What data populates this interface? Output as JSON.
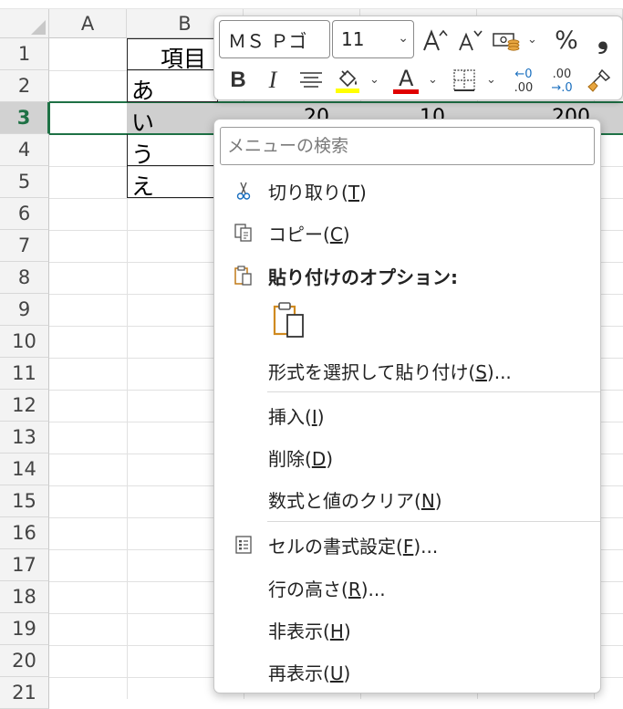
{
  "sheet": {
    "columns": [
      "A",
      "B"
    ],
    "rows": [
      "1",
      "2",
      "3",
      "4",
      "5",
      "6",
      "7",
      "8",
      "9",
      "10",
      "11",
      "12",
      "13",
      "14",
      "15",
      "16",
      "17",
      "18",
      "19",
      "20",
      "21"
    ],
    "cells": {
      "b1": "項目",
      "b2": "あ",
      "b3": "い",
      "b4": "う",
      "b5": "え",
      "c3": "20",
      "d3": "10",
      "e3": "200"
    },
    "selected_row": "3",
    "accent_color": "#1e7145"
  },
  "mini_toolbar": {
    "font_name": "ＭＳ Ｐゴ",
    "font_size": "11",
    "icons": [
      "increase-font-size-icon",
      "decrease-font-size-icon",
      "accounting-format-icon",
      "percent-style-icon",
      "comma-style-icon",
      "bold-icon",
      "italic-icon",
      "center-align-icon",
      "fill-color-icon",
      "font-color-icon",
      "borders-icon",
      "increase-decimal-icon",
      "decrease-decimal-icon",
      "format-painter-icon"
    ],
    "bold_label": "B",
    "italic_label": "I",
    "percent_label": "%",
    "comma_label": "❟",
    "font_color_label": "A",
    "fill_highlight_color": "#ffff00",
    "font_color": "#e00000",
    "increase_decimal_top": "←0",
    "increase_decimal_bottom": ".00",
    "decrease_decimal_top": ".00",
    "decrease_decimal_bottom": "→.0"
  },
  "context_menu": {
    "search_placeholder": "メニューの検索",
    "items": {
      "cut": {
        "text": "切り取り(",
        "key": "T",
        "tail": ")"
      },
      "copy": {
        "text": "コピー(",
        "key": "C",
        "tail": ")"
      },
      "paste_options": {
        "text": "貼り付けのオプション:"
      },
      "paste_special": {
        "text": "形式を選択して貼り付け(",
        "key": "S",
        "tail": ")..."
      },
      "insert": {
        "text": "挿入(",
        "key": "I",
        "tail": ")"
      },
      "delete": {
        "text": "削除(",
        "key": "D",
        "tail": ")"
      },
      "clear_contents": {
        "text": "数式と値のクリア(",
        "key": "N",
        "tail": ")"
      },
      "format_cells": {
        "text": "セルの書式設定(",
        "key": "F",
        "tail": ")..."
      },
      "row_height": {
        "text": "行の高さ(",
        "key": "R",
        "tail": ")..."
      },
      "hide": {
        "text": "非表示(",
        "key": "H",
        "tail": ")"
      },
      "unhide": {
        "text": "再表示(",
        "key": "U",
        "tail": ")"
      }
    }
  }
}
